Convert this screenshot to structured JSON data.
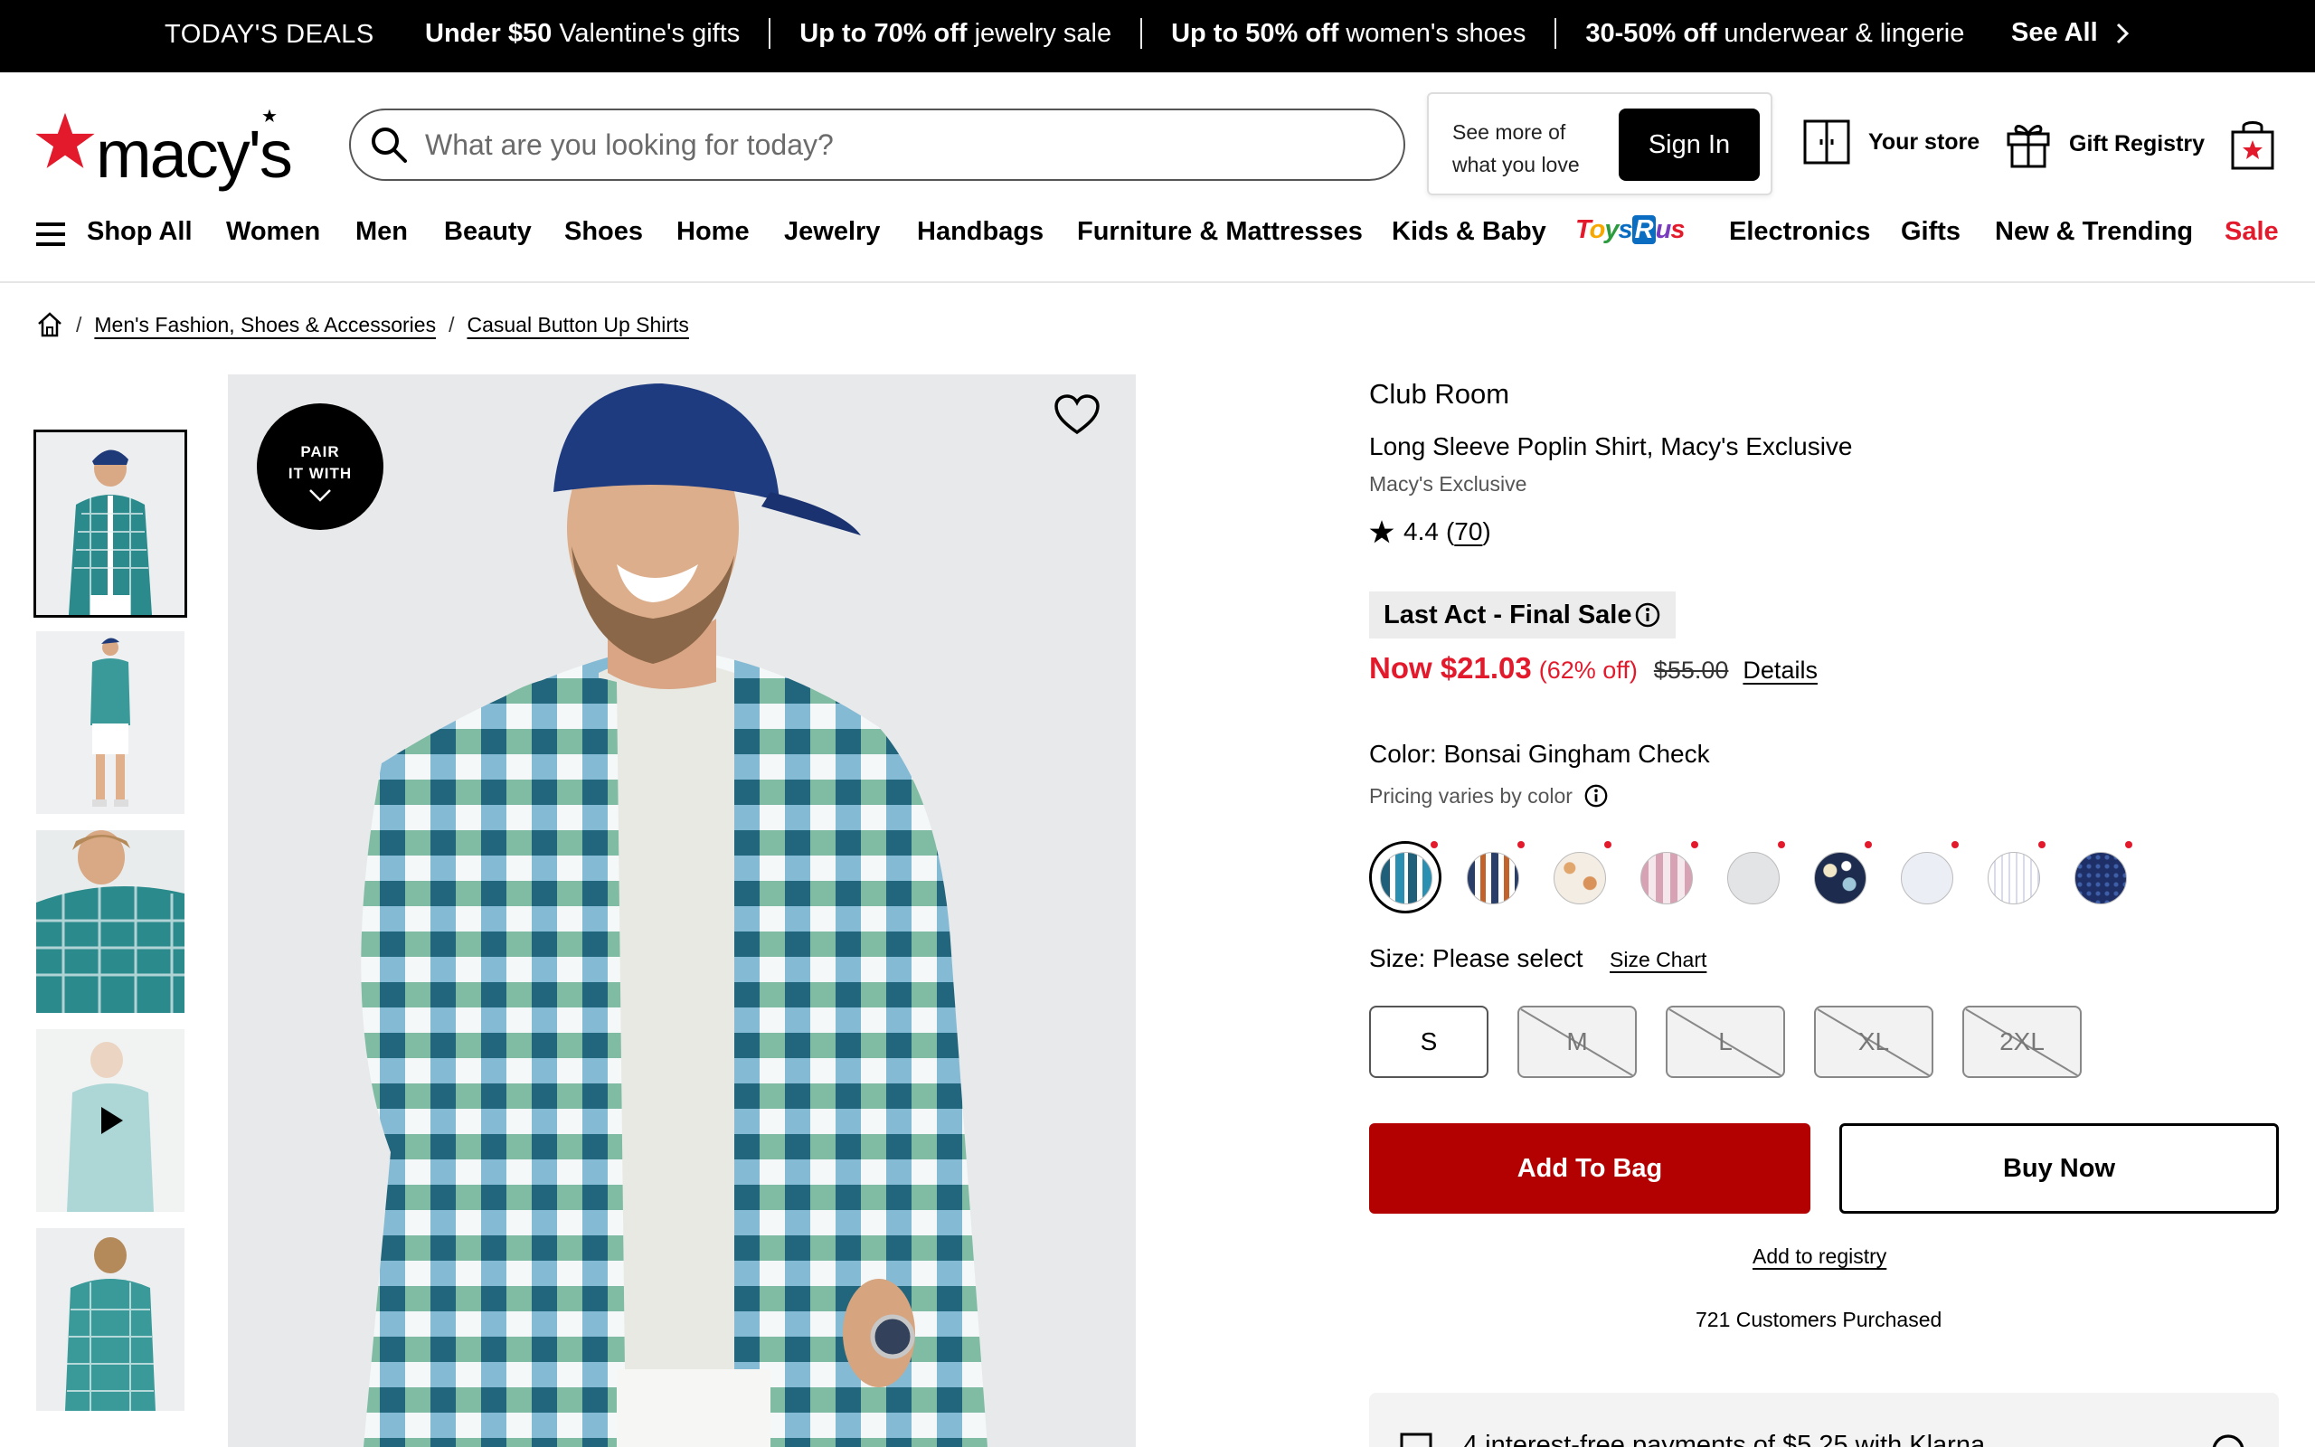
{
  "promo": {
    "deals_label": "TODAY'S DEALS",
    "items": [
      {
        "bold": "Under $50",
        "rest": "Valentine's gifts"
      },
      {
        "bold": "Up to 70% off",
        "rest": "jewelry sale"
      },
      {
        "bold": "Up to 50% off",
        "rest": "women's shoes"
      },
      {
        "bold": "30-50% off",
        "rest": "underwear & lingerie"
      }
    ],
    "see_all": "See All"
  },
  "header": {
    "logo_text": "macy's",
    "search_placeholder": "What are you looking for today?",
    "signin_prompt": "See more of what you love",
    "signin_label": "Sign In",
    "your_store": "Your store",
    "gift_registry": "Gift Registry"
  },
  "nav": {
    "shop_all": "Shop All",
    "items": [
      "Women",
      "Men",
      "Beauty",
      "Shoes",
      "Home",
      "Jewelry",
      "Handbags",
      "Furniture & Mattresses",
      "Kids & Baby"
    ],
    "toys_logo": "ToysRus",
    "items2": [
      "Electronics",
      "Gifts",
      "New & Trending"
    ],
    "sale": "Sale"
  },
  "breadcrumb": [
    "Men's Fashion, Shoes & Accessories",
    "Casual Button Up Shirts"
  ],
  "image": {
    "pair_line1": "PAIR",
    "pair_line2": "IT WITH"
  },
  "product": {
    "brand": "Club Room",
    "name": "Long Sleeve Poplin Shirt, Macy's Exclusive",
    "exclusive": "Macy's Exclusive",
    "rating": "4.4",
    "review_count": "70",
    "badge": "Last Act - Final Sale",
    "price_now": "Now $21.03",
    "price_off": "(62% off)",
    "price_orig": "$55.00",
    "details": "Details",
    "color_label": "Color: Bonsai Gingham Check",
    "pricing_varies": "Pricing varies by color",
    "size_label": "Size: Please select",
    "size_chart": "Size Chart",
    "sizes": [
      "S",
      "M",
      "L",
      "XL",
      "2XL"
    ],
    "add_to_bag": "Add To Bag",
    "buy_now": "Buy Now",
    "add_registry": "Add to registry",
    "purchased": "721 Customers Purchased",
    "klarna": "4 interest-free payments of $5.25 with Klarna"
  },
  "colors": {
    "brand_red": "#e21a2c",
    "add_to_bag": "#b30000",
    "promo_bg": "#000000"
  }
}
